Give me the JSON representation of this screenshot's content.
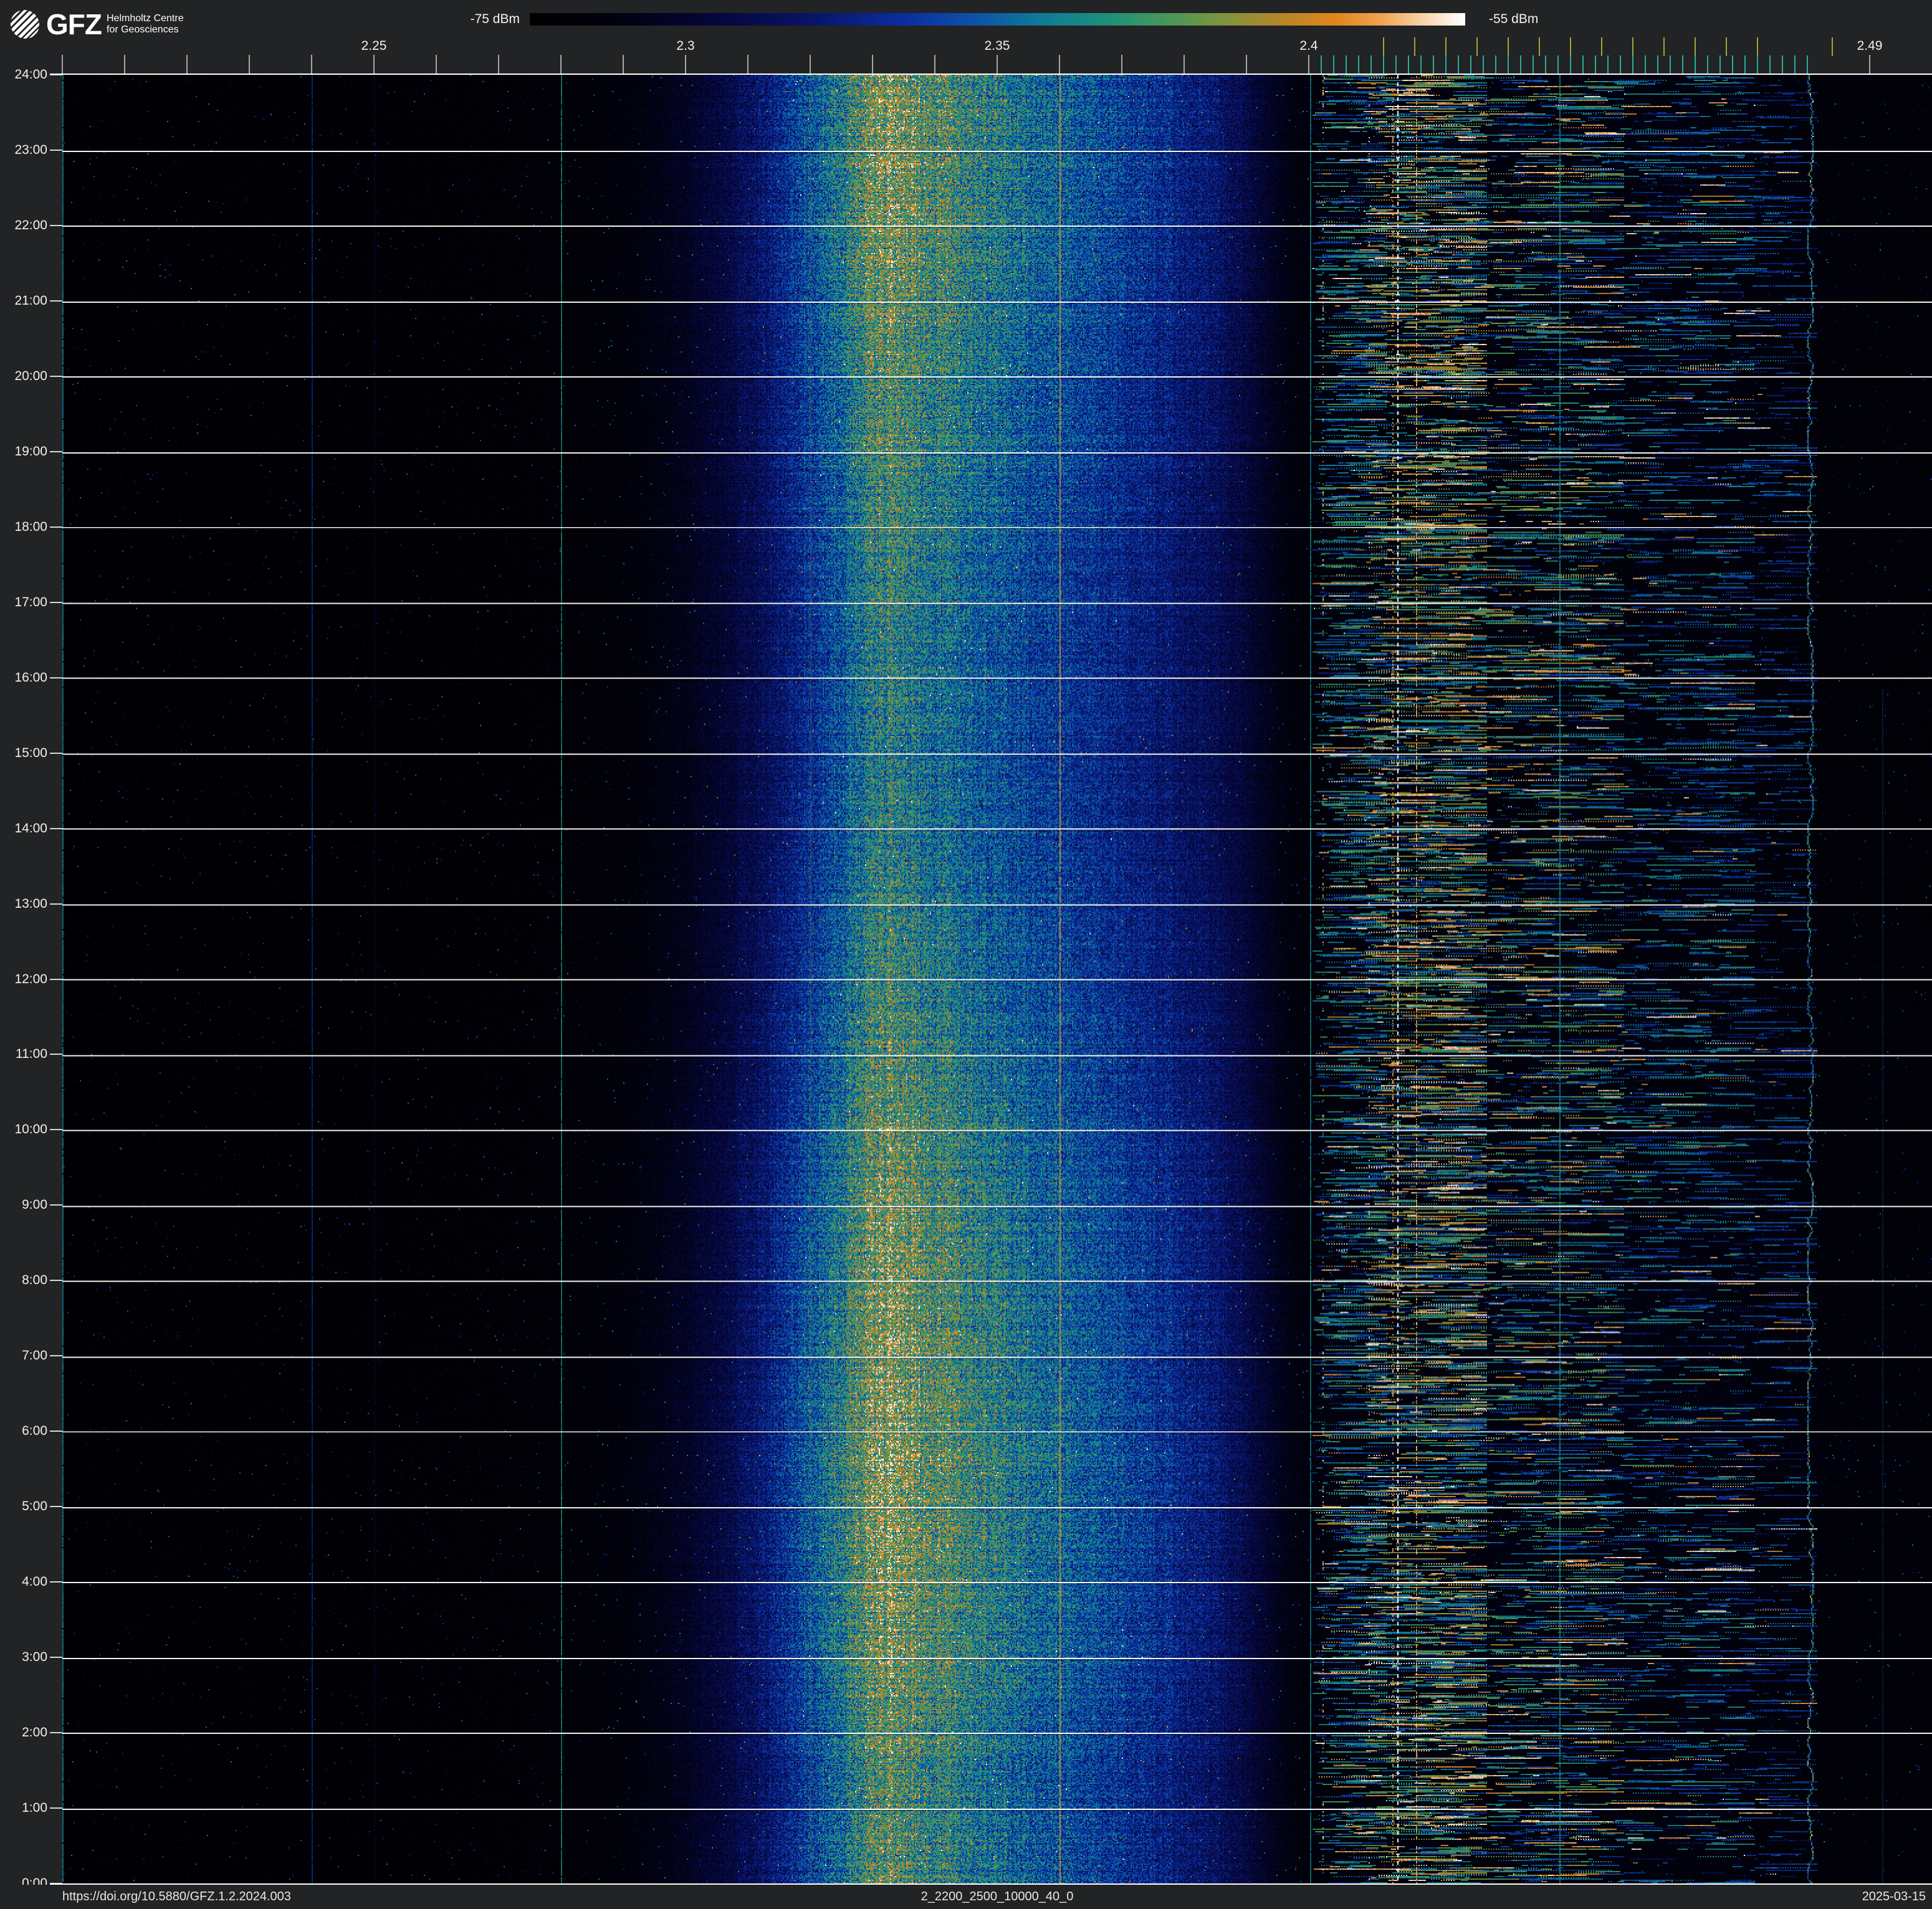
{
  "header": {
    "logo": {
      "brand": "GFZ",
      "line1": "Helmholtz Centre",
      "line2": "for Geosciences"
    },
    "colorbar": {
      "min_label": "-75 dBm",
      "max_label": "-55 dBm"
    }
  },
  "footer": {
    "doi": "https://doi.org/10.5880/GFZ.1.2.2024.003",
    "filename": "2_2200_2500_10000_40_0",
    "date": "2025-03-15"
  },
  "chart_data": {
    "type": "heatmap",
    "subtype": "radio-frequency-spectrogram",
    "x_axis": {
      "unit": "GHz",
      "min": 2.2,
      "max": 2.5,
      "minor_tick_step_ghz": 0.01,
      "minor_tick_range": [
        2.2,
        2.4
      ],
      "extra_minor_tick": 2.49,
      "labeled_ticks": [
        {
          "text": "2.25",
          "f": 2.25
        },
        {
          "text": "2.3",
          "f": 2.3
        },
        {
          "text": "2.35",
          "f": 2.35
        },
        {
          "text": "2.4",
          "f": 2.4
        },
        {
          "text": "2.49",
          "f": 2.49
        }
      ]
    },
    "y_axis": {
      "direction": "top-to-bottom",
      "hour_labels": [
        "24:00",
        "23:00",
        "22:00",
        "21:00",
        "20:00",
        "19:00",
        "18:00",
        "17:00",
        "16:00",
        "15:00",
        "14:00",
        "13:00",
        "12:00",
        "11:00",
        "10:00",
        "9:00",
        "8:00",
        "7:00",
        "6:00",
        "5:00",
        "4:00",
        "3:00",
        "2:00",
        "1:00",
        "0:00"
      ]
    },
    "power_scale": {
      "min_dbm": -75,
      "max_dbm": -55
    },
    "colormap": [
      {
        "t": 0.0,
        "color": "#000000"
      },
      {
        "t": 0.1,
        "color": "#020210"
      },
      {
        "t": 0.2,
        "color": "#05063c"
      },
      {
        "t": 0.3,
        "color": "#081464"
      },
      {
        "t": 0.4,
        "color": "#0a2da0"
      },
      {
        "t": 0.48,
        "color": "#0c55a8"
      },
      {
        "t": 0.55,
        "color": "#0e7d96"
      },
      {
        "t": 0.62,
        "color": "#1e9078"
      },
      {
        "t": 0.68,
        "color": "#46975a"
      },
      {
        "t": 0.74,
        "color": "#7d9440"
      },
      {
        "t": 0.8,
        "color": "#b3862b"
      },
      {
        "t": 0.86,
        "color": "#e08518"
      },
      {
        "t": 0.91,
        "color": "#f0a350"
      },
      {
        "t": 0.95,
        "color": "#f7cfa0"
      },
      {
        "t": 1.0,
        "color": "#ffffff"
      }
    ],
    "wifi_channel_ticks": {
      "color": "#a8a23a",
      "freqs": [
        2.412,
        2.417,
        2.422,
        2.427,
        2.432,
        2.437,
        2.442,
        2.447,
        2.452,
        2.457,
        2.462,
        2.467,
        2.472,
        2.484
      ]
    },
    "ble_channel_ticks": {
      "color": "#2bab9f",
      "start": 2.402,
      "stop": 2.48,
      "step": 0.002
    },
    "noise_band_profile": [
      [
        2.2,
        0.03
      ],
      [
        2.25,
        0.032
      ],
      [
        2.272,
        0.04
      ],
      [
        2.285,
        0.055
      ],
      [
        2.293,
        0.085
      ],
      [
        2.3,
        0.135
      ],
      [
        2.306,
        0.195
      ],
      [
        2.312,
        0.285
      ],
      [
        2.318,
        0.405
      ],
      [
        2.323,
        0.505
      ],
      [
        2.327,
        0.595
      ],
      [
        2.33,
        0.655
      ],
      [
        2.333,
        0.695
      ],
      [
        2.336,
        0.67
      ],
      [
        2.34,
        0.625
      ],
      [
        2.346,
        0.57
      ],
      [
        2.353,
        0.52
      ],
      [
        2.36,
        0.47
      ],
      [
        2.368,
        0.42
      ],
      [
        2.376,
        0.36
      ],
      [
        2.384,
        0.295
      ],
      [
        2.39,
        0.215
      ],
      [
        2.394,
        0.135
      ],
      [
        2.397,
        0.092
      ],
      [
        2.4,
        0.075
      ],
      [
        2.403,
        0.078
      ],
      [
        2.468,
        0.078
      ],
      [
        2.479,
        0.062
      ],
      [
        2.5,
        0.052
      ]
    ],
    "activity_regions": [
      {
        "f0": 2.4005,
        "f1": 2.409,
        "row_prob": 0.55,
        "max_segments": 4,
        "i_min": 0.35,
        "i_max": 0.7,
        "hot_prob": 0.1
      },
      {
        "f0": 2.409,
        "f1": 2.425,
        "row_prob": 0.8,
        "max_segments": 7,
        "i_min": 0.4,
        "i_max": 0.8,
        "hot_prob": 0.25
      },
      {
        "f0": 2.425,
        "f1": 2.447,
        "row_prob": 0.7,
        "max_segments": 6,
        "i_min": 0.35,
        "i_max": 0.75,
        "hot_prob": 0.15
      },
      {
        "f0": 2.447,
        "f1": 2.468,
        "row_prob": 0.55,
        "max_segments": 5,
        "i_min": 0.3,
        "i_max": 0.65,
        "hot_prob": 0.08
      },
      {
        "f0": 2.468,
        "f1": 2.478,
        "row_prob": 0.3,
        "max_segments": 3,
        "i_min": 0.28,
        "i_max": 0.55,
        "hot_prob": 0.04
      }
    ],
    "spur_lines": [
      {
        "f": 2.2001,
        "t": 0.56,
        "alpha": 0.9,
        "y0": 0
      },
      {
        "f": 2.24,
        "t": 0.38,
        "alpha": 0.85,
        "y0": 0
      },
      {
        "f": 2.25,
        "t": 0.3,
        "alpha": 0.3,
        "y0": 0
      },
      {
        "f": 2.28,
        "t": 0.62,
        "alpha": 0.8,
        "y0": 0
      },
      {
        "f": 2.32,
        "t": 0.74,
        "alpha": 0.3,
        "y0": 0
      },
      {
        "f": 2.36,
        "t": 0.84,
        "alpha": 0.92,
        "y0": 0
      },
      {
        "f": 2.4001,
        "t": 0.58,
        "alpha": 0.8,
        "y0": 0
      },
      {
        "f": 2.4401,
        "t": 0.58,
        "alpha": 0.9,
        "y0": 0
      },
      {
        "f": 2.492,
        "t": 0.5,
        "alpha": 0.28,
        "y0": 0.34
      }
    ],
    "carrier_line": {
      "f": 2.4803,
      "i": 0.62
    },
    "markers": [
      {
        "f": 2.4142,
        "style": "dash-white",
        "density": 0.5
      },
      {
        "f": 2.4172,
        "style": "dots-orange",
        "density": 0.5
      },
      {
        "f": 2.4135,
        "style": "dots-orange",
        "density": 0.28
      },
      {
        "f": 2.4022,
        "style": "dots-mixed",
        "density": 0.12
      },
      {
        "f": 2.4097,
        "style": "dots-white",
        "density": 0.05
      }
    ],
    "grid": {
      "hour_lines": true,
      "color": "#ffffff"
    }
  }
}
